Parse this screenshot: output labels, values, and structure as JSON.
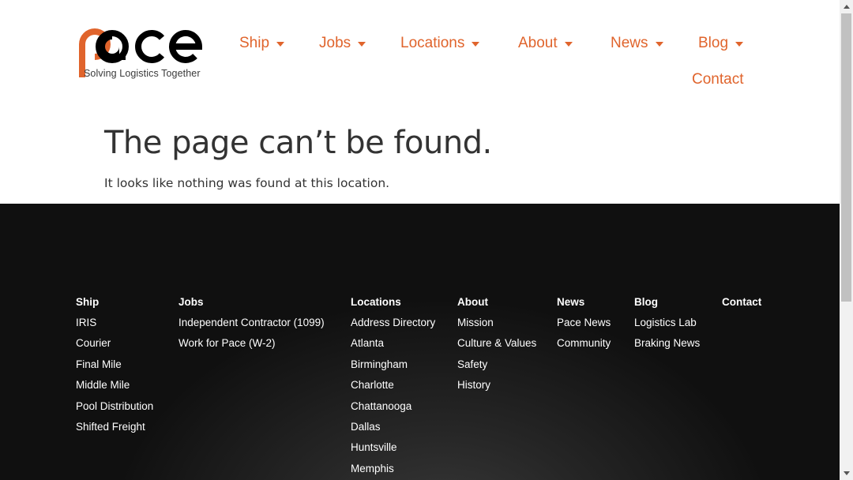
{
  "logo": {
    "icon": "pace-logo",
    "text": "pace",
    "tagline": "Solving Logistics Together",
    "brand_color": "#e0642c"
  },
  "nav": {
    "ship": "Ship",
    "jobs": "Jobs",
    "locations": "Locations",
    "about": "About",
    "news": "News",
    "blog": "Blog",
    "contact": "Contact"
  },
  "main": {
    "title": "The page can’t be found.",
    "subtitle": "It looks like nothing was found at this location."
  },
  "footer": {
    "ship": {
      "heading": "Ship",
      "links": [
        "IRIS",
        "Courier",
        "Final Mile",
        "Middle Mile",
        "Pool Distribution",
        "Shifted Freight"
      ]
    },
    "jobs": {
      "heading": "Jobs",
      "links": [
        "Independent Contractor (1099)",
        "Work for Pace (W-2)"
      ]
    },
    "locations": {
      "heading": "Locations",
      "links": [
        "Address Directory",
        "Atlanta",
        "Birmingham",
        "Charlotte",
        "Chattanooga",
        "Dallas",
        "Huntsville",
        "Memphis"
      ]
    },
    "about": {
      "heading": "About",
      "links": [
        "Mission",
        "Culture & Values",
        "Safety",
        "History"
      ]
    },
    "news": {
      "heading": "News",
      "links": [
        "Pace News",
        "Community"
      ]
    },
    "blog": {
      "heading": "Blog",
      "links": [
        "Logistics Lab",
        "Braking News"
      ]
    },
    "contact": {
      "heading": "Contact",
      "links": []
    }
  },
  "colors": {
    "accent": "#e0642c",
    "text": "#333333",
    "footer_bg": "#1a1a1a"
  }
}
